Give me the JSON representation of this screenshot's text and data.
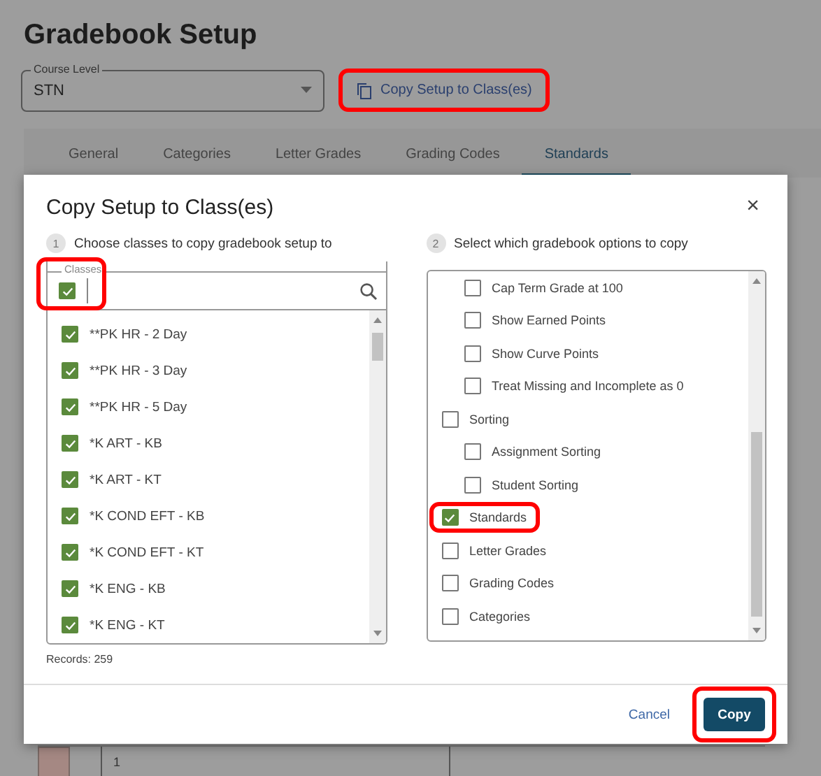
{
  "page": {
    "title": "Gradebook Setup"
  },
  "course_level": {
    "label": "Course Level",
    "value": "STN"
  },
  "copy_setup_button": {
    "label": "Copy Setup to Class(es)",
    "highlighted": true
  },
  "tabs": [
    {
      "label": "General",
      "selected": false
    },
    {
      "label": "Categories",
      "selected": false
    },
    {
      "label": "Letter Grades",
      "selected": false
    },
    {
      "label": "Grading Codes",
      "selected": false
    },
    {
      "label": "Standards",
      "selected": true
    }
  ],
  "background_row": {
    "cell": "1"
  },
  "dialog": {
    "title": "Copy Setup to Class(es)",
    "close": "×",
    "step_1": {
      "number": "1",
      "text": "Choose classes to copy gradebook setup to"
    },
    "classes": {
      "label": "Classes",
      "select_all": {
        "checked": true,
        "highlighted": true
      },
      "items": [
        {
          "label": "**PK HR - 2 Day",
          "checked": true
        },
        {
          "label": "**PK HR - 3 Day",
          "checked": true
        },
        {
          "label": "**PK HR - 5 Day",
          "checked": true
        },
        {
          "label": "*K ART - KB",
          "checked": true
        },
        {
          "label": "*K ART - KT",
          "checked": true
        },
        {
          "label": "*K COND EFT - KB",
          "checked": true
        },
        {
          "label": "*K COND EFT - KT",
          "checked": true
        },
        {
          "label": "*K ENG - KB",
          "checked": true
        },
        {
          "label": "*K ENG - KT",
          "checked": true
        }
      ],
      "records": "Records: 259"
    },
    "step_2": {
      "number": "2",
      "text": "Select which gradebook options to copy"
    },
    "options": [
      {
        "children": [
          {
            "label": "Cap Term Grade at 100",
            "checked": false,
            "highlighted": false
          },
          {
            "label": "Show Earned Points",
            "checked": false,
            "highlighted": false
          },
          {
            "label": "Show Curve Points",
            "checked": false,
            "highlighted": false
          },
          {
            "label": "Treat Missing and Incomplete as 0",
            "checked": false,
            "highlighted": false
          }
        ]
      },
      {
        "label": "Sorting",
        "checked": false,
        "highlighted": false,
        "children": [
          {
            "label": "Assignment Sorting",
            "checked": false,
            "highlighted": false
          },
          {
            "label": "Student Sorting",
            "checked": false,
            "highlighted": false
          }
        ]
      },
      {
        "label": "Standards",
        "checked": true,
        "highlighted": true
      },
      {
        "label": "Letter Grades",
        "checked": false,
        "highlighted": false
      },
      {
        "label": "Grading Codes",
        "checked": false,
        "highlighted": false
      },
      {
        "label": "Categories",
        "checked": false,
        "highlighted": false
      }
    ],
    "cancel": "Cancel",
    "copy": {
      "label": "Copy",
      "highlighted": true
    }
  }
}
